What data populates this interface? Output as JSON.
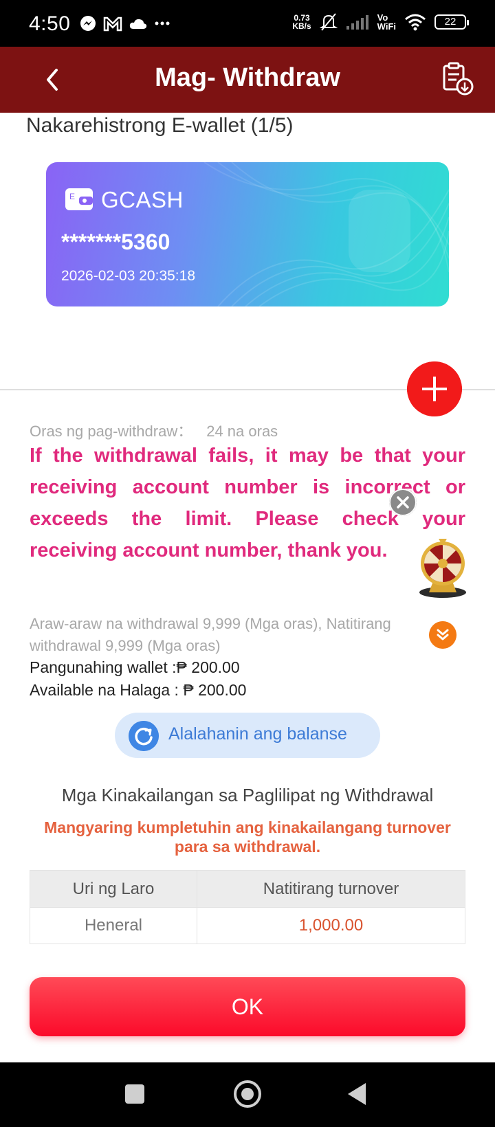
{
  "status_bar": {
    "time": "4:50",
    "net_speed_value": "0.73",
    "net_speed_unit": "KB/s",
    "vowifi_top": "Vo",
    "vowifi_bottom": "WiFi",
    "battery": "22",
    "icons": [
      "messenger-icon",
      "mail-icon",
      "cloud-icon",
      "more-dots-icon",
      "mute-bell-icon",
      "signal-icon",
      "wifi-icon",
      "battery-icon"
    ]
  },
  "header": {
    "title": "Mag- Withdraw",
    "background": "#7d1212",
    "icons": [
      "back-icon",
      "records-download-icon"
    ]
  },
  "wallets": {
    "section_title": "Nakarehistrong E-wallet (1/5)",
    "card": {
      "brand": "GCASH",
      "logo_letter": "E",
      "account": "*******5360",
      "date": "2026-02-03 20:35:18"
    }
  },
  "info": {
    "time_label": "Oras ng pag-withdraw：",
    "time_value": "24 na oras",
    "warning": "If the withdrawal fails, it may be that your receiving account number is incorrect or exceeds the limit. Please check your receiving account number, thank you.",
    "warning_color": "#e02a7d",
    "daily_limit": "Araw-araw na withdrawal 9,999 (Mga oras), Natitirang withdrawal 9,999 (Mga oras)",
    "main_wallet": "Pangunahing wallet :₱ 200.00",
    "available": "Available na Halaga : ₱ 200.00"
  },
  "refresh": {
    "label": "Alalahanin ang balanse"
  },
  "requirements": {
    "title": "Mga Kinakailangan sa Paglilipat ng Withdrawal",
    "note": "Mangyaring kumpletuhin ang kinakailangang turnover para sa withdrawal.",
    "columns": [
      "Uri ng Laro",
      "Natitirang turnover"
    ],
    "rows": [
      [
        "Heneral",
        "1,000.00"
      ]
    ]
  },
  "ok_button": {
    "label": "OK",
    "color": "#fb0a2a"
  },
  "nav": {
    "icons": [
      "recents-icon",
      "home-icon",
      "back-triangle-icon"
    ]
  }
}
